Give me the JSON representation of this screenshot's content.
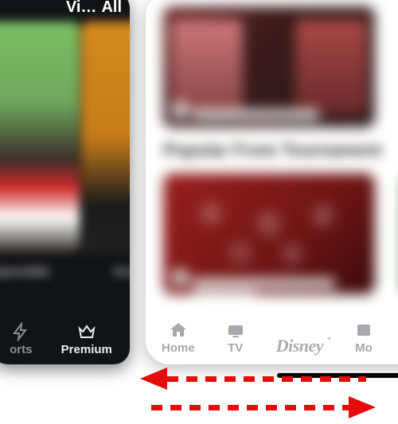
{
  "left_app": {
    "header": {
      "vi_label": "Vi…",
      "all_label": "All"
    },
    "posters": [
      {
        "caption": "Impossible"
      },
      {
        "caption": "#Leh"
      }
    ],
    "nav": {
      "sports_label": "orts",
      "premium_label": "Premium"
    }
  },
  "right_app": {
    "section_title": "Popular From Tournament",
    "cards": [
      {
        "caption": "Replay · Anaheim vs Atlanta"
      },
      {
        "caption_line1": "Women's Championship Winning",
        "caption_line2": "the West"
      }
    ],
    "nav": {
      "home_label": "Home",
      "tv_label": "TV",
      "disney_label": "Disney",
      "movies_label": "Mo"
    }
  },
  "gesture": {
    "direction_top": "left",
    "direction_bottom": "right"
  }
}
